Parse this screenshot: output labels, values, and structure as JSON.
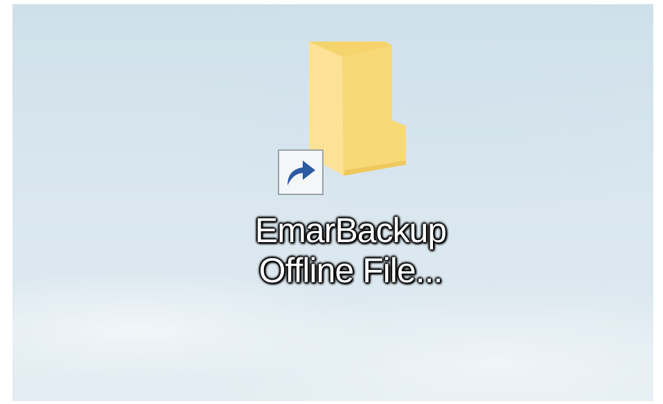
{
  "desktop": {
    "shortcut": {
      "label_line1": "EmarBackup",
      "label_line2": "Offline File...",
      "icon": "folder-icon",
      "overlay": "shortcut-arrow-icon"
    }
  },
  "colors": {
    "folder_light": "#fbe08f",
    "folder_dark": "#f0c84f",
    "arrow": "#2c5aa3",
    "desktop_bg": "#d8e6ee"
  }
}
